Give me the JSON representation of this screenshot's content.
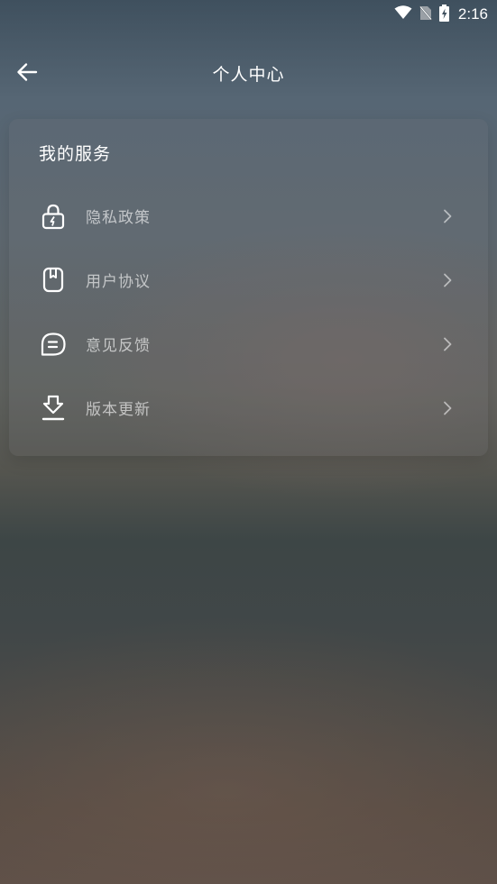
{
  "status_bar": {
    "time": "2:16",
    "icons": [
      "wifi-icon",
      "no-sim-icon",
      "battery-charging-icon"
    ]
  },
  "header": {
    "title": "个人中心",
    "back_icon": "arrow-left-icon"
  },
  "services": {
    "title": "我的服务",
    "items": [
      {
        "label": "隐私政策",
        "icon": "lock-icon"
      },
      {
        "label": "用户协议",
        "icon": "bookmark-doc-icon"
      },
      {
        "label": "意见反馈",
        "icon": "chat-bubble-icon"
      },
      {
        "label": "版本更新",
        "icon": "download-icon"
      }
    ]
  },
  "colors": {
    "text_primary": "#ffffff",
    "text_secondary": "#bdbdbd"
  }
}
